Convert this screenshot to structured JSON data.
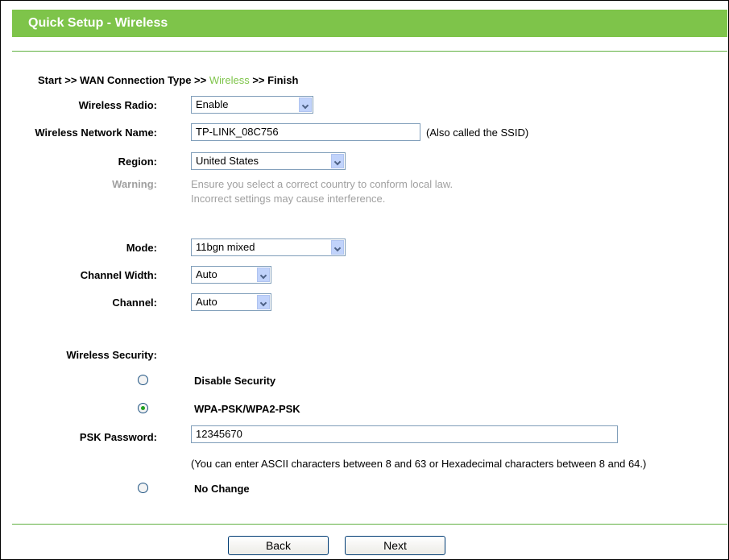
{
  "header": {
    "title": "Quick Setup - Wireless"
  },
  "breadcrumb": {
    "prefix": "Start >> WAN Connection Type >> ",
    "current": "Wireless",
    "suffix": " >> Finish"
  },
  "form": {
    "radio": {
      "label": "Wireless Radio:",
      "value": "Enable"
    },
    "ssid": {
      "label": "Wireless Network Name:",
      "value": "TP-LINK_08C756",
      "note": "(Also called the SSID)"
    },
    "region": {
      "label": "Region:",
      "value": "United States"
    },
    "warning": {
      "label": "Warning:",
      "line1": "Ensure you select a correct country to conform local law.",
      "line2": "Incorrect settings may cause interference."
    },
    "mode": {
      "label": "Mode:",
      "value": "11bgn mixed"
    },
    "channel_width": {
      "label": "Channel Width:",
      "value": "Auto"
    },
    "channel": {
      "label": "Channel:",
      "value": "Auto"
    },
    "security": {
      "label": "Wireless Security:",
      "options": [
        {
          "label": "Disable Security",
          "checked": false
        },
        {
          "label": "WPA-PSK/WPA2-PSK",
          "checked": true
        },
        {
          "label": "No Change",
          "checked": false
        }
      ],
      "psk_label": "PSK Password:",
      "psk_value": "12345670",
      "psk_note": "(You can enter ASCII characters between 8 and 63 or Hexadecimal characters between 8 and 64.)"
    }
  },
  "buttons": {
    "back": "Back",
    "next": "Next"
  },
  "colors": {
    "accent": "#7ec44a",
    "muted_text": "#a0a0a0"
  }
}
